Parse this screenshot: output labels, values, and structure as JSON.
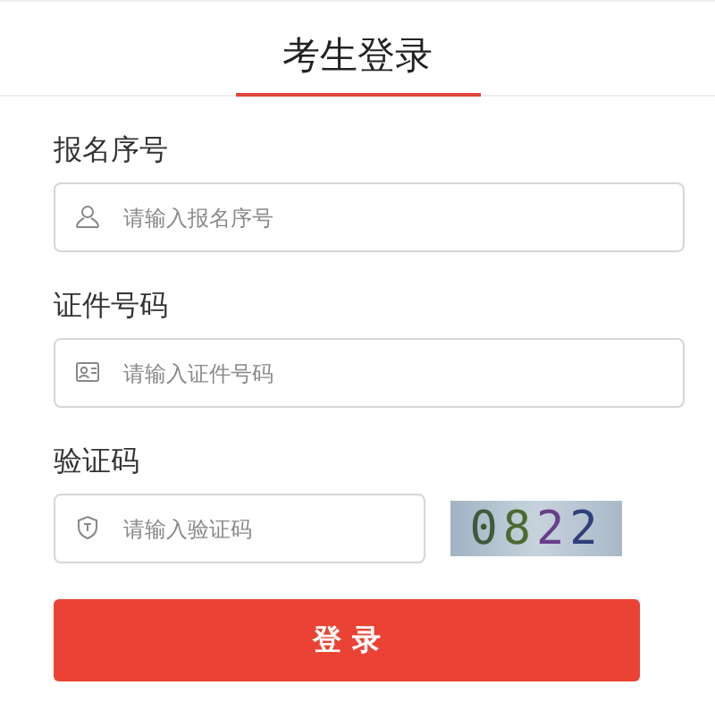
{
  "title": "考生登录",
  "fields": [
    {
      "label": "报名序号",
      "placeholder": "请输入报名序号",
      "kind": "person"
    },
    {
      "label": "证件号码",
      "placeholder": "请输入证件号码",
      "kind": "card"
    },
    {
      "label": "验证码",
      "placeholder": "请输入验证码",
      "kind": "shield",
      "captcha": "0822"
    }
  ],
  "submit": "登 录"
}
